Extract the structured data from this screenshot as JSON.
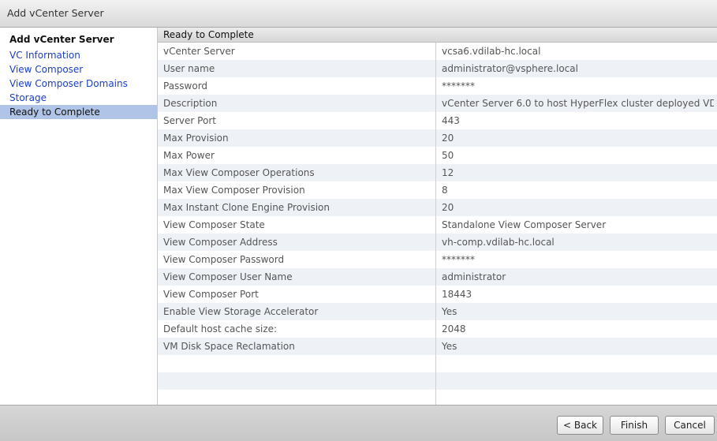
{
  "window": {
    "title": "Add vCenter Server"
  },
  "nav": {
    "header": "Add vCenter Server",
    "items": [
      {
        "label": "VC Information",
        "active": false
      },
      {
        "label": "View Composer",
        "active": false
      },
      {
        "label": "View Composer Domains",
        "active": false
      },
      {
        "label": "Storage",
        "active": false
      },
      {
        "label": "Ready to Complete",
        "active": true
      }
    ]
  },
  "main": {
    "header": "Ready to Complete",
    "rows": [
      {
        "key": "vCenter Server",
        "value": "vcsa6.vdilab-hc.local"
      },
      {
        "key": "User name",
        "value": "administrator@vsphere.local"
      },
      {
        "key": "Password",
        "value": "*******"
      },
      {
        "key": "Description",
        "value": "vCenter Server 6.0 to host HyperFlex cluster deployed VD"
      },
      {
        "key": "Server Port",
        "value": "443"
      },
      {
        "key": "Max Provision",
        "value": "20"
      },
      {
        "key": "Max Power",
        "value": "50"
      },
      {
        "key": "Max View Composer Operations",
        "value": "12"
      },
      {
        "key": "Max View Composer Provision",
        "value": "8"
      },
      {
        "key": "Max Instant Clone Engine Provision",
        "value": "20"
      },
      {
        "key": "View Composer State",
        "value": "Standalone View Composer Server"
      },
      {
        "key": "View Composer Address",
        "value": "vh-comp.vdilab-hc.local"
      },
      {
        "key": "View Composer Password",
        "value": "*******"
      },
      {
        "key": "View Composer User Name",
        "value": "administrator"
      },
      {
        "key": "View Composer Port",
        "value": "18443"
      },
      {
        "key": "Enable View Storage Accelerator",
        "value": "Yes"
      },
      {
        "key": "Default host cache size:",
        "value": "2048"
      },
      {
        "key": "VM Disk Space Reclamation",
        "value": "Yes"
      }
    ]
  },
  "footer": {
    "back_label": "< Back",
    "finish_label": "Finish",
    "cancel_label": "Cancel"
  }
}
